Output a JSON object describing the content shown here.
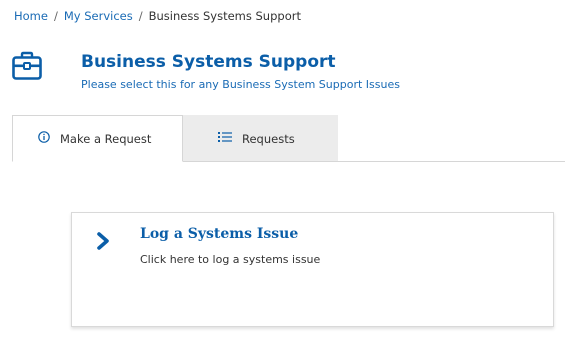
{
  "breadcrumb": {
    "home": "Home",
    "sep1": "/",
    "my_services": "My Services",
    "sep2": "/",
    "current": "Business Systems Support"
  },
  "header": {
    "icon": "briefcase-icon",
    "title": "Business Systems Support",
    "subtitle": "Please select this for any Business System Support Issues"
  },
  "tabs": [
    {
      "label": "Make a Request",
      "icon": "info-circle-icon",
      "active": true
    },
    {
      "label": "Requests",
      "icon": "list-icon",
      "active": false
    }
  ],
  "card": {
    "icon": "chevron-right-icon",
    "title": "Log a Systems Issue",
    "description": "Click here to log a systems issue"
  },
  "colors": {
    "accent": "#0b5ea8",
    "link": "#1a6bb5",
    "inactive_tab": "#ececec",
    "border": "#d6d6d6"
  }
}
